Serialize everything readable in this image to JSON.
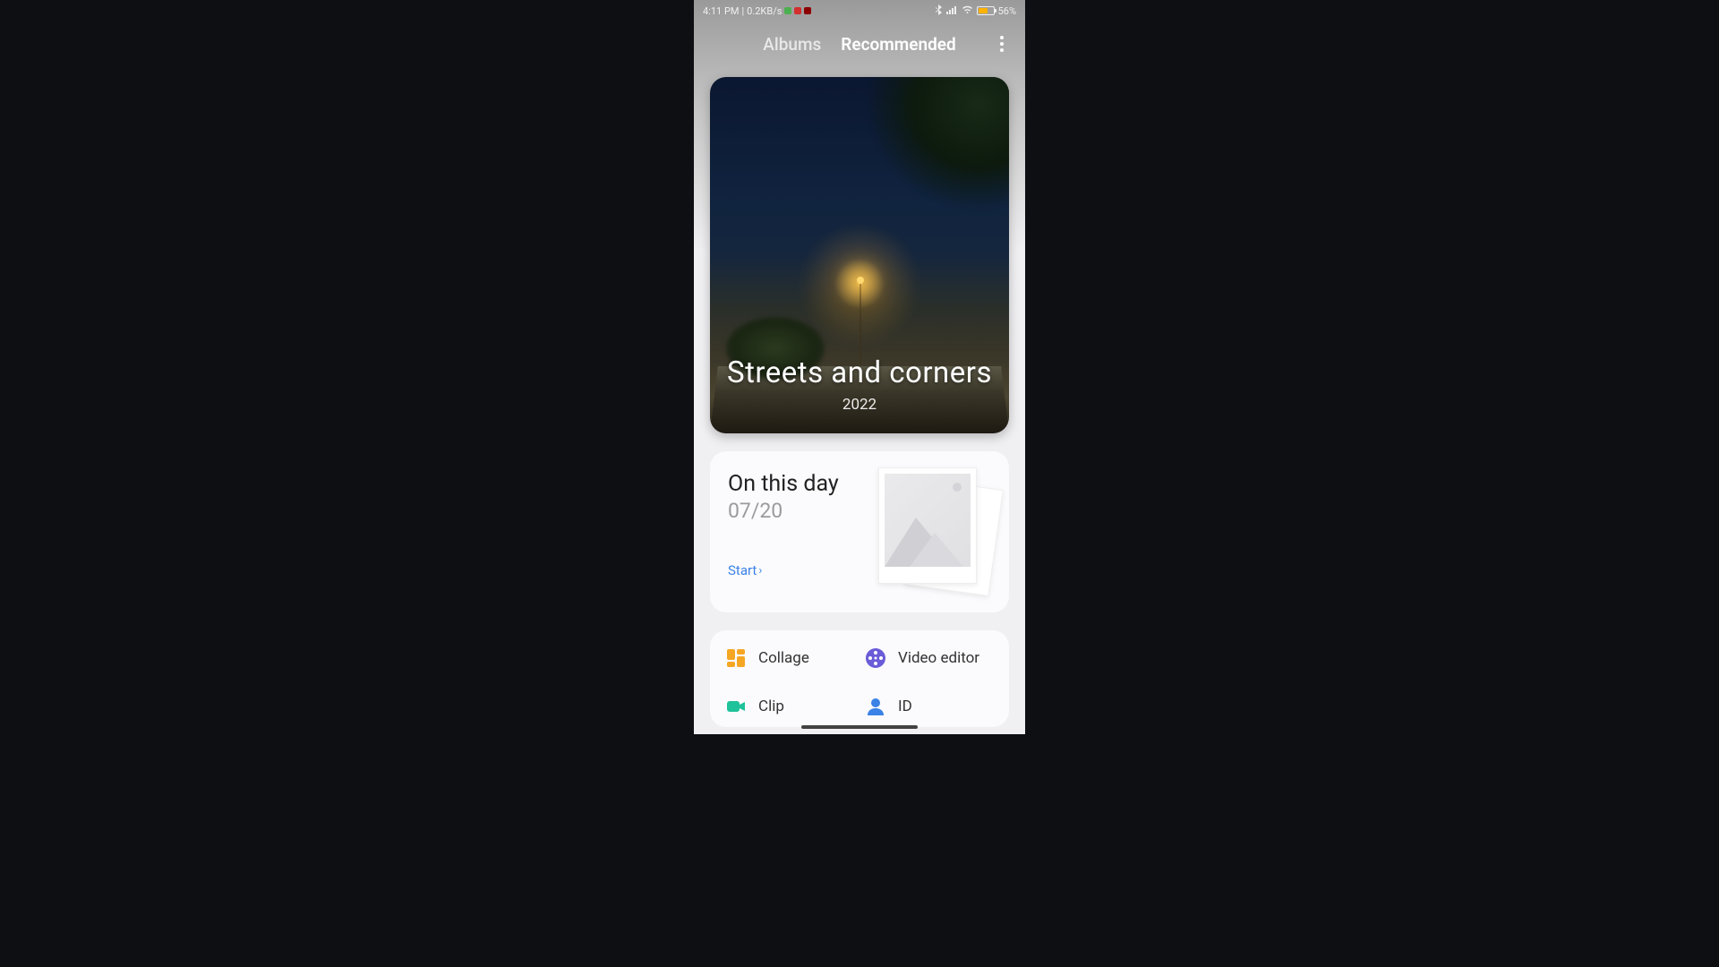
{
  "status_bar": {
    "time": "4:11 PM",
    "net_speed": "0.2KB/s",
    "battery_percent": "56%",
    "battery_level_pct": 56
  },
  "tabs": {
    "albums": "Albums",
    "recommended": "Recommended"
  },
  "hero": {
    "title": "Streets and corners",
    "subtitle": "2022"
  },
  "on_this_day": {
    "title": "On this day",
    "date": "07/20",
    "start": "Start"
  },
  "tools": {
    "collage": "Collage",
    "video_editor": "Video editor",
    "clip": "Clip",
    "id": "ID"
  }
}
